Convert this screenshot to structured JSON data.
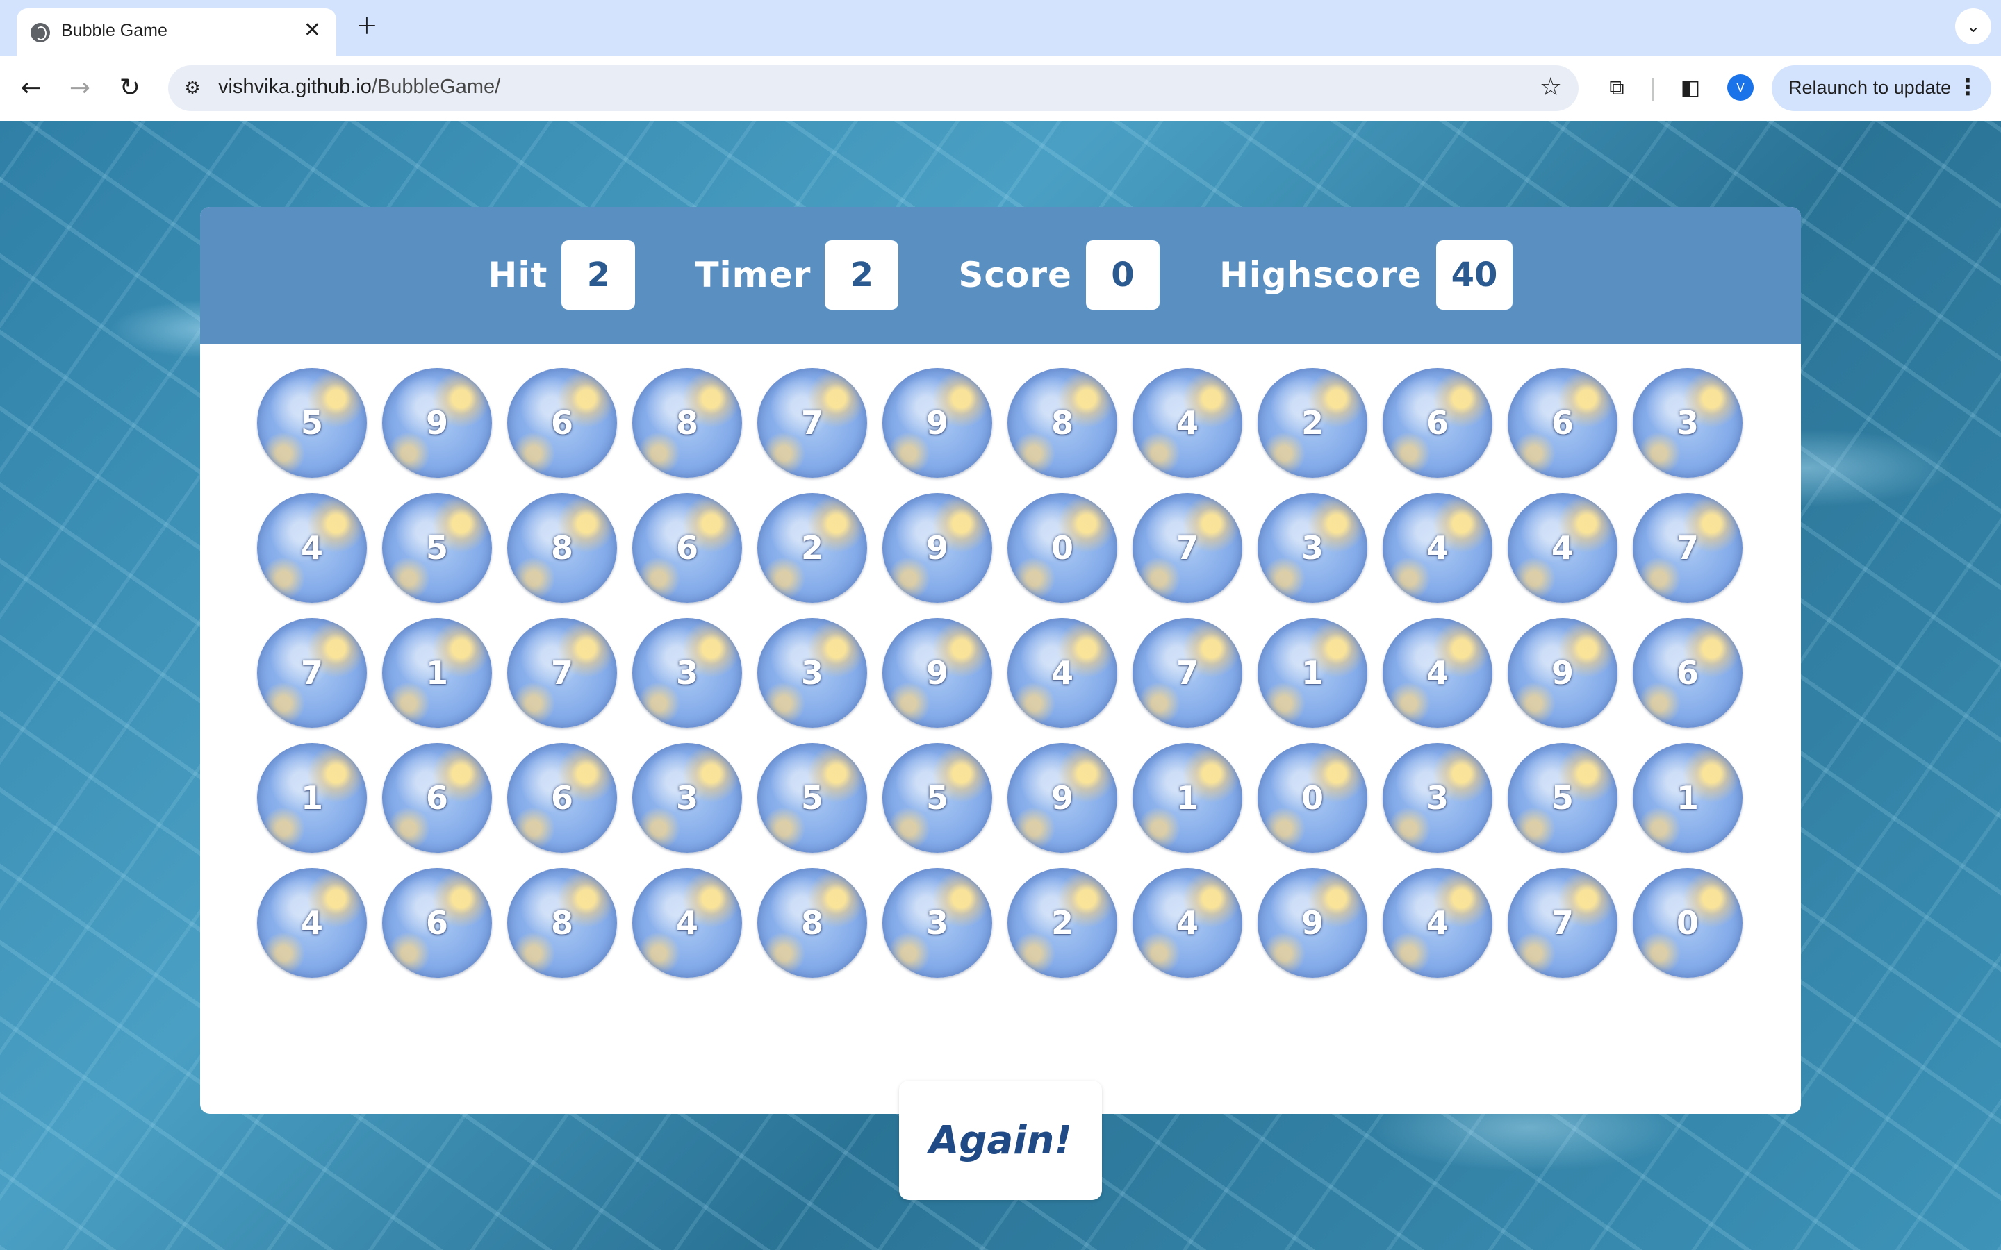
{
  "browser": {
    "tab_title": "Bubble Game",
    "tab_close": "✕",
    "new_tab": "+",
    "tab_menu": "⌄",
    "url_host": "vishvika.github.io",
    "url_path": "/BubbleGame/",
    "avatar_initial": "V",
    "relaunch_label": "Relaunch to update",
    "icons": [
      "globe-icon",
      "close-icon",
      "plus-icon",
      "chevron-down-icon",
      "back-icon",
      "forward-icon",
      "reload-icon",
      "site-info-icon",
      "star-icon",
      "extensions-icon",
      "side-panel-icon",
      "more-vert-icon"
    ]
  },
  "game": {
    "stats": [
      {
        "label": "Hit",
        "value": "2"
      },
      {
        "label": "Timer",
        "value": "2"
      },
      {
        "label": "Score",
        "value": "0"
      },
      {
        "label": "Highscore",
        "value": "40"
      }
    ],
    "bubbles": [
      "5",
      "9",
      "6",
      "8",
      "7",
      "9",
      "8",
      "4",
      "2",
      "6",
      "6",
      "3",
      "4",
      "5",
      "8",
      "6",
      "2",
      "9",
      "0",
      "7",
      "3",
      "4",
      "4",
      "7",
      "7",
      "1",
      "7",
      "3",
      "3",
      "9",
      "4",
      "7",
      "1",
      "4",
      "9",
      "6",
      "1",
      "6",
      "6",
      "3",
      "5",
      "5",
      "9",
      "1",
      "0",
      "3",
      "5",
      "1",
      "4",
      "6",
      "8",
      "4",
      "8",
      "3",
      "2",
      "4",
      "9",
      "4",
      "7",
      "0"
    ],
    "again_label": "Again!"
  },
  "colors": {
    "panel_header": "#5a8fc2",
    "stat_value": "#2a5a8f",
    "again_text": "#1f4a85",
    "tabbar": "#d3e3fd"
  }
}
